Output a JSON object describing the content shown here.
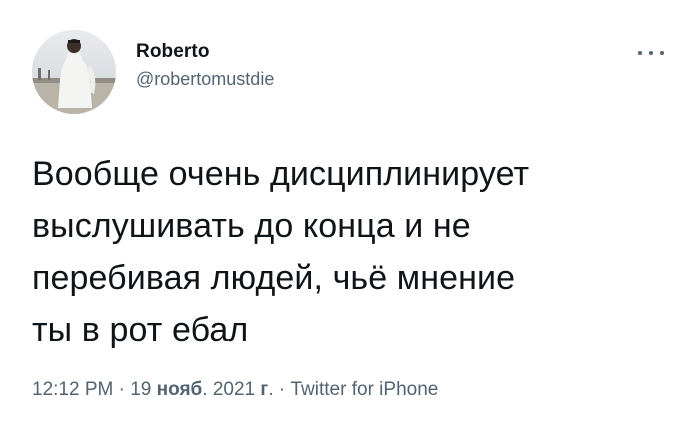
{
  "tweet": {
    "display_name": "Roberto",
    "handle": "@robertomustdie",
    "text": "Вообще очень дисциплинирует\nвыслушивать до конца и не\nперебивая людей, чьё мнение\nты в рот ебал",
    "time": "12:12 PM",
    "separator": " · ",
    "date_day": "19 ",
    "date_month": "нояб",
    "date_rest": ". 2021 ",
    "date_year_suffix": "г",
    "date_end": ".",
    "separator2": " · ",
    "source": "Twitter for iPhone",
    "more_icon": "more-horizontal-icon"
  },
  "colors": {
    "text": "#0f1419",
    "secondary": "#536471",
    "background": "#ffffff"
  }
}
